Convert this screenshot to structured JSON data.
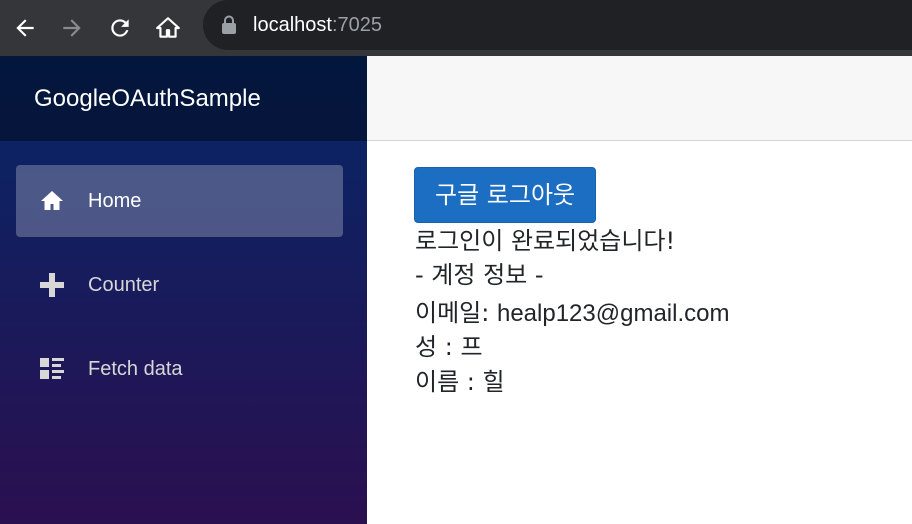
{
  "browser": {
    "url_host": "localhost",
    "url_port": ":7025"
  },
  "sidebar": {
    "brand": "GoogleOAuthSample",
    "items": [
      {
        "label": "Home",
        "icon": "home-icon",
        "active": true
      },
      {
        "label": "Counter",
        "icon": "plus-icon",
        "active": false
      },
      {
        "label": "Fetch data",
        "icon": "list-rich-icon",
        "active": false
      }
    ]
  },
  "main": {
    "logout_label": "구글 로그아웃",
    "status_text": "로그인이 완료되었습니다!",
    "account_header": "- 계정 정보 -",
    "email_label": "이메일: ",
    "email_value": "healp123@gmail.com",
    "last_name_label": "성 : ",
    "last_name_value": "프",
    "first_name_label": "이름 : ",
    "first_name_value": "힐"
  },
  "colors": {
    "primary": "#1b6ec2",
    "sidebar_top": "#052767",
    "sidebar_bottom": "#3a0647",
    "chrome": "#35363a"
  }
}
